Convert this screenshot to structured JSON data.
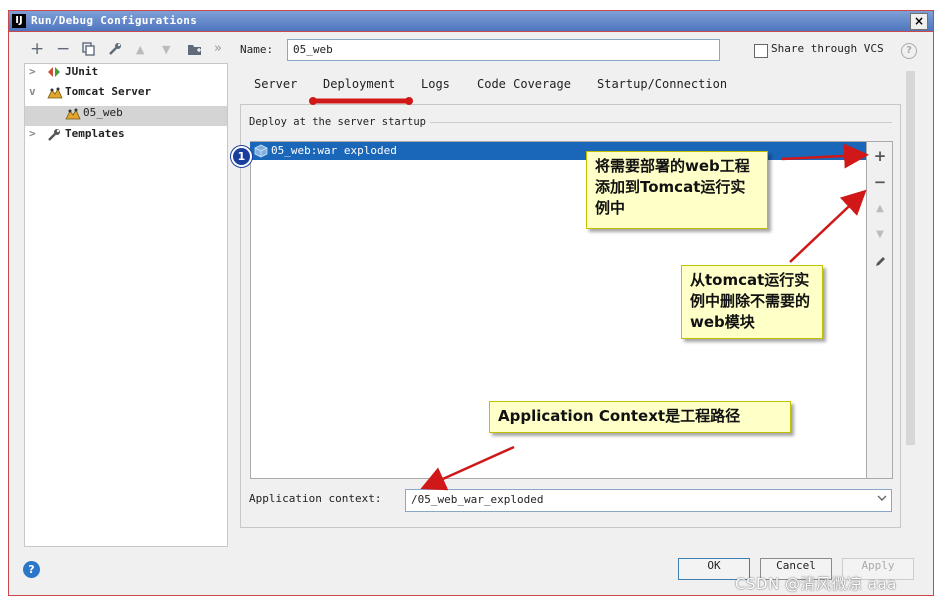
{
  "window": {
    "title": "Run/Debug Configurations",
    "app_icon": "IJ",
    "close_label": "×"
  },
  "toolbar": {
    "add": "+",
    "remove": "−",
    "copy_icon": "copy-icon",
    "wrench_icon": "wrench-icon",
    "up": "▲",
    "down": "▼",
    "folder_icon": "folder-icon",
    "more": "»"
  },
  "tree": {
    "items": [
      {
        "label": "JUnit",
        "chevron": ">",
        "icon": "junit-icon"
      },
      {
        "label": "Tomcat Server",
        "chevron": "v",
        "icon": "tomcat-icon"
      },
      {
        "label": "05_web",
        "icon": "tomcat-icon",
        "selected": true
      },
      {
        "label": "Templates",
        "chevron": ">",
        "icon": "wrench-icon"
      }
    ]
  },
  "name_field": {
    "label": "Name:",
    "value": "05_web"
  },
  "share": {
    "label": "Share through VCS",
    "help": "?"
  },
  "tabs": [
    "Server",
    "Deployment",
    "Logs",
    "Code Coverage",
    "Startup/Connection"
  ],
  "active_tab": "Deployment",
  "deploy": {
    "section_label": "Deploy at the server startup",
    "items": [
      "05_web:war exploded"
    ],
    "badge": "1"
  },
  "side_tools": {
    "add": "+",
    "remove": "−",
    "up": "▲",
    "down": "▼",
    "edit_icon": "pencil-icon"
  },
  "app_context": {
    "label": "Application context:",
    "value": "/05_web_war_exploded"
  },
  "callouts": {
    "add_hint": "将需要部署的web工程添加到Tomcat运行实例中",
    "remove_hint": "从tomcat运行实例中删除不需要的web模块",
    "context_hint": "Application Context是工程路径"
  },
  "buttons": {
    "ok": "OK",
    "cancel": "Cancel",
    "apply": "Apply"
  },
  "help_icon": "?",
  "watermark": "CSDN @清风微凉 aaa",
  "colors": {
    "title_bar": "#4e76bf",
    "selection": "#1a66b8",
    "annotation": "#d01818",
    "callout_bg": "#ffffc8"
  }
}
